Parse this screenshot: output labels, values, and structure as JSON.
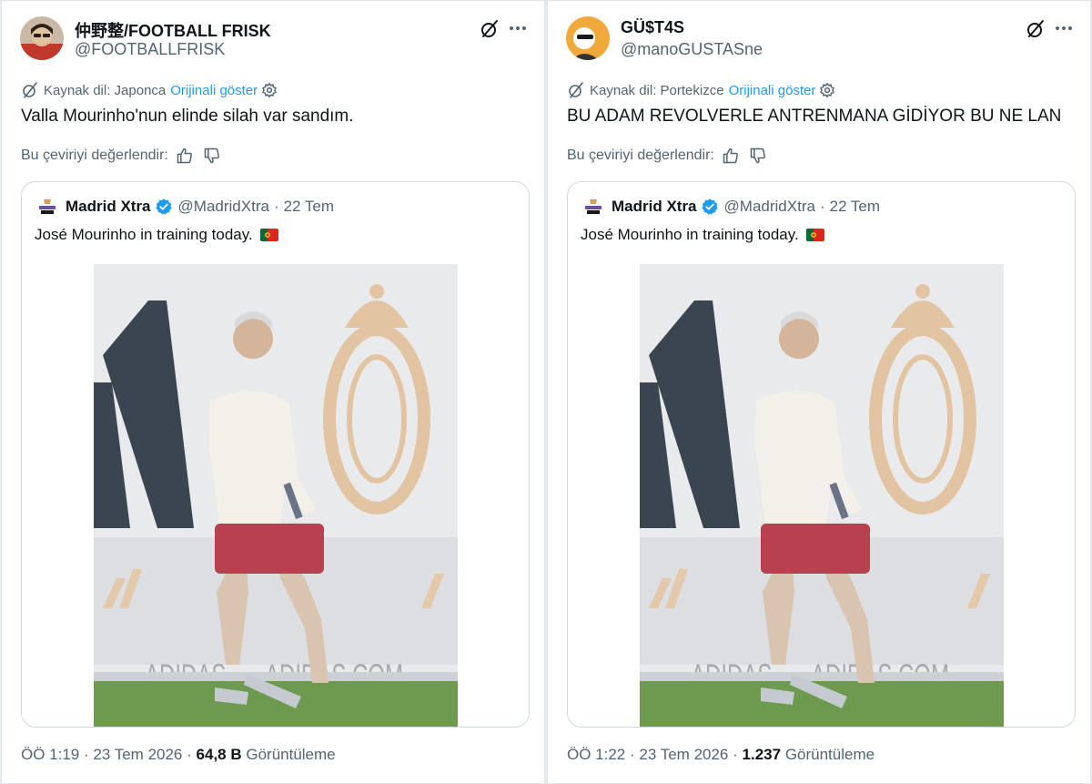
{
  "left": {
    "author_name": "仲野整/FOOTBALL FRISK",
    "author_handle": "@FOOTBALLFRISK",
    "source_text": "Kaynak dil: Japonca",
    "show_original": "Orijinali göster",
    "tweet_text": "Valla Mourinho'nun elinde silah var sandım.",
    "rate_label": "Bu çeviriyi değerlendir:",
    "quote": {
      "name": "Madrid Xtra",
      "handle": "@MadridXtra",
      "sep": "·",
      "date": "22 Tem",
      "text": "José Mourinho in training today."
    },
    "time": "ÖÖ 1:19",
    "date": "23 Tem 2026",
    "views_count": "64,8 B",
    "views_label": "Görüntüleme",
    "dot": "·"
  },
  "right": {
    "author_name": "GÜ$T4S",
    "author_handle": "@manoGUSTASne",
    "source_text": "Kaynak dil: Portekizce",
    "show_original": "Orijinali göster",
    "tweet_text": "BU ADAM REVOLVERLE ANTRENMANA GİDİYOR BU NE LAN",
    "rate_label": "Bu çeviriyi değerlendir:",
    "quote": {
      "name": "Madrid Xtra",
      "handle": "@MadridXtra",
      "sep": "·",
      "date": "22 Tem",
      "text": "José Mourinho in training today."
    },
    "time": "ÖÖ 1:22",
    "date": "23 Tem 2026",
    "views_count": "1.237",
    "views_label": "Görüntüleme",
    "dot": "·"
  },
  "icons": {
    "grok": "grok-icon",
    "more": "more-icon",
    "translate": "translate-icon",
    "settings": "gear-icon",
    "like": "thumbs-up-icon",
    "dislike": "thumbs-down-icon",
    "verified": "verified-badge-icon",
    "flag": "portugal-flag-icon"
  },
  "colors": {
    "link": "#1d9bf0",
    "secondary_text": "#536471",
    "primary_text": "#0f1419",
    "border": "#cfd9de",
    "verified": "#1d9bf0"
  }
}
